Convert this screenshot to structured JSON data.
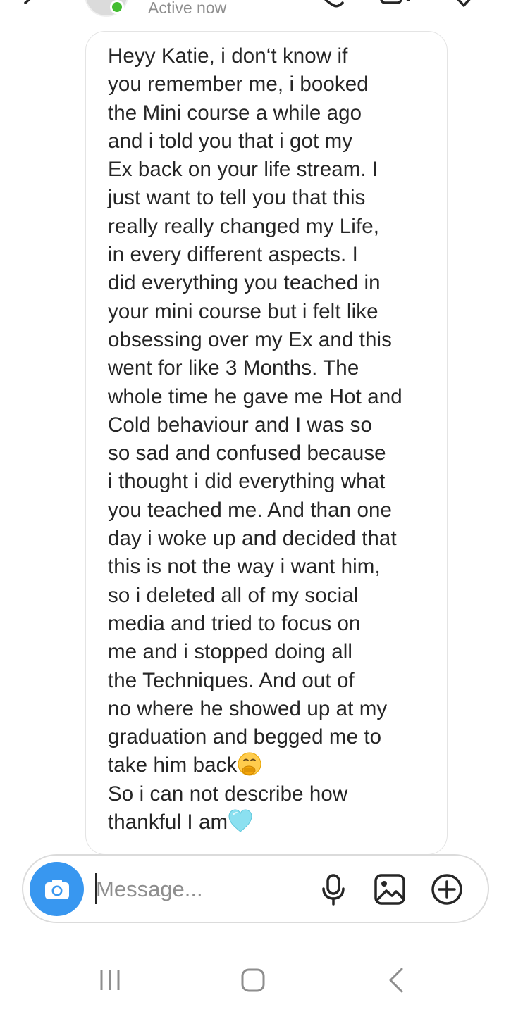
{
  "header": {
    "status": "Active now",
    "icons": {
      "back": "arrow-back-icon",
      "call": "phone-icon",
      "video": "video-camera-icon",
      "info": "info-icon"
    },
    "active_color": "#44bd32"
  },
  "thread": {
    "message": {
      "text": "Heyy Katie, i don‘t know if\nyou remember me, i booked\nthe Mini course a while ago\nand i told you that i got my\nEx back on your life stream. I\njust want to tell you that this\nreally really changed my Life,\nin every different aspects. I\ndid everything you teached in\nyour mini course but i felt like\nobsessing over my Ex and this\nwent for like 3 Months. The\nwhole time he gave me Hot and\nCold behaviour and I was so\nso sad and confused because\ni thought i did everything what\nyou teached me. And than one\nday i woke up and decided that\nthis is not the way i want him,\nso i deleted all of my social\nmedia and tried to focus on\nme and i stopped doing all\nthe Techniques. And out of\nno where he showed up at my\ngraduation and begged me to\ntake him back",
      "text_end": "So i can not describe how\nthankful I am",
      "emojis": [
        "face-with-hand-over-mouth-emoji",
        "light-blue-heart-emoji"
      ]
    }
  },
  "composer": {
    "placeholder": "Message...",
    "camera_color": "#3897f0",
    "icons": [
      "camera-icon",
      "microphone-icon",
      "gallery-icon",
      "add-circle-icon"
    ]
  },
  "navigation": {
    "buttons": [
      "recents-icon",
      "home-icon",
      "back-icon"
    ]
  }
}
